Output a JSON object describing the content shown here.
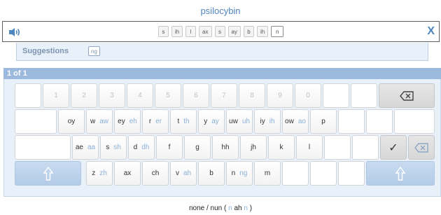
{
  "word": "psilocybin",
  "phonemes": [
    "s",
    "ih",
    "l",
    "ax",
    "s",
    "ay",
    "b",
    "ih",
    "n"
  ],
  "active_phoneme_index": 8,
  "close_label": "X",
  "suggestions": {
    "label": "Suggestions",
    "items": [
      "ng"
    ]
  },
  "page_indicator": "1 of 1",
  "keyboard": {
    "row1": [
      "",
      "1",
      "2",
      "3",
      "4",
      "5",
      "6",
      "7",
      "8",
      "9",
      "0",
      "",
      ""
    ],
    "row2": [
      {
        "main": "",
        "alt": ""
      },
      {
        "main": "oy",
        "alt": ""
      },
      {
        "main": "w",
        "alt": "aw"
      },
      {
        "main": "ey",
        "alt": "eh"
      },
      {
        "main": "r",
        "alt": "er"
      },
      {
        "main": "t",
        "alt": "th"
      },
      {
        "main": "y",
        "alt": "ay"
      },
      {
        "main": "uw",
        "alt": "uh"
      },
      {
        "main": "iy",
        "alt": "ih"
      },
      {
        "main": "ow",
        "alt": "ao"
      },
      {
        "main": "p",
        "alt": ""
      },
      {
        "main": "",
        "alt": ""
      },
      {
        "main": "",
        "alt": ""
      },
      {
        "main": "",
        "alt": ""
      }
    ],
    "row3": [
      {
        "main": "ae",
        "alt": "aa"
      },
      {
        "main": "s",
        "alt": "sh"
      },
      {
        "main": "d",
        "alt": "dh"
      },
      {
        "main": "f",
        "alt": ""
      },
      {
        "main": "g",
        "alt": ""
      },
      {
        "main": "hh",
        "alt": ""
      },
      {
        "main": "jh",
        "alt": ""
      },
      {
        "main": "k",
        "alt": ""
      },
      {
        "main": "l",
        "alt": ""
      },
      {
        "main": "",
        "alt": ""
      },
      {
        "main": "",
        "alt": ""
      }
    ],
    "check_label": "✓",
    "row4": [
      {
        "main": "z",
        "alt": "zh"
      },
      {
        "main": "ax",
        "alt": ""
      },
      {
        "main": "ch",
        "alt": ""
      },
      {
        "main": "v",
        "alt": "ah"
      },
      {
        "main": "b",
        "alt": ""
      },
      {
        "main": "n",
        "alt": "ng"
      },
      {
        "main": "m",
        "alt": ""
      },
      {
        "main": "",
        "alt": ""
      },
      {
        "main": "",
        "alt": ""
      },
      {
        "main": "",
        "alt": ""
      }
    ],
    "shift_label": "⇧"
  },
  "status": {
    "pre": "none / nun ( ",
    "a": "n",
    "mid": " ah ",
    "b": "n",
    "post": " )"
  },
  "colors": {
    "accent": "#4e86c0",
    "panel": "#e8f0fa",
    "header": "#9cb9de",
    "alt_text": "#8cb0d8"
  }
}
